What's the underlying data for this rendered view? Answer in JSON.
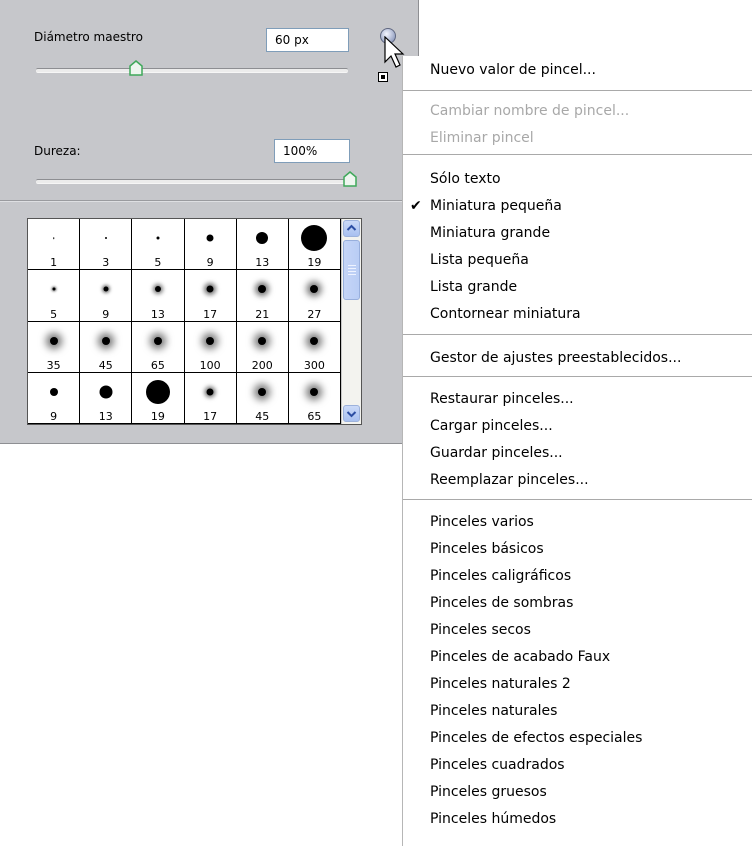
{
  "panel": {
    "master_diameter_label": "Diámetro maestro",
    "master_diameter_value": "60 px",
    "master_diameter_slider": 0.32,
    "hardness_label": "Dureza:",
    "hardness_value": "100%",
    "hardness_slider": 1.0
  },
  "brush_grid": {
    "cells": [
      {
        "label": "1",
        "size": 1.5,
        "blur": 0
      },
      {
        "label": "3",
        "size": 2,
        "blur": 0
      },
      {
        "label": "5",
        "size": 3,
        "blur": 0
      },
      {
        "label": "9",
        "size": 7,
        "blur": 0
      },
      {
        "label": "13",
        "size": 12,
        "blur": 0
      },
      {
        "label": "19",
        "size": 26,
        "blur": 0
      },
      {
        "label": "5",
        "size": 3,
        "blur": 1
      },
      {
        "label": "9",
        "size": 5,
        "blur": 1.5
      },
      {
        "label": "13",
        "size": 6,
        "blur": 2
      },
      {
        "label": "17",
        "size": 7,
        "blur": 2.5
      },
      {
        "label": "21",
        "size": 8,
        "blur": 3
      },
      {
        "label": "27",
        "size": 8,
        "blur": 3.5
      },
      {
        "label": "35",
        "size": 8,
        "blur": 4
      },
      {
        "label": "45",
        "size": 8,
        "blur": 4
      },
      {
        "label": "65",
        "size": 8,
        "blur": 4
      },
      {
        "label": "100",
        "size": 8,
        "blur": 4
      },
      {
        "label": "200",
        "size": 8,
        "blur": 4
      },
      {
        "label": "300",
        "size": 8,
        "blur": 4
      },
      {
        "label": "9",
        "size": 8,
        "blur": 0
      },
      {
        "label": "13",
        "size": 13,
        "blur": 0
      },
      {
        "label": "19",
        "size": 24,
        "blur": 0
      },
      {
        "label": "17",
        "size": 7,
        "blur": 2
      },
      {
        "label": "45",
        "size": 8,
        "blur": 4
      },
      {
        "label": "65",
        "size": 8,
        "blur": 4
      }
    ]
  },
  "menu": {
    "new_brush": "Nuevo valor de pincel...",
    "rename_brush": "Cambiar nombre de pincel...",
    "delete_brush": "Eliminar pincel",
    "text_only": "Sólo texto",
    "small_thumbnail": "Miniatura pequeña",
    "large_thumbnail": "Miniatura grande",
    "small_list": "Lista pequeña",
    "large_list": "Lista grande",
    "stroke_thumbnail": "Contornear miniatura",
    "preset_manager": "Gestor de ajustes preestablecidos...",
    "reset_brushes": "Restaurar pinceles...",
    "load_brushes": "Cargar pinceles...",
    "save_brushes": "Guardar pinceles...",
    "replace_brushes": "Reemplazar pinceles...",
    "libraries": [
      "Pinceles varios",
      "Pinceles básicos",
      "Pinceles caligráficos",
      "Pinceles de sombras",
      "Pinceles secos",
      "Pinceles de acabado Faux",
      "Pinceles naturales 2",
      "Pinceles naturales",
      "Pinceles de efectos especiales",
      "Pinceles cuadrados",
      "Pinceles gruesos",
      "Pinceles húmedos"
    ],
    "checked_item": "small_thumbnail"
  },
  "colors": {
    "panel_bg": "#c6c7cb",
    "slider_thumb": "#3fa85a",
    "disabled_text": "#a8a8a8",
    "scrollbar_accent": "#a8c0f0"
  }
}
